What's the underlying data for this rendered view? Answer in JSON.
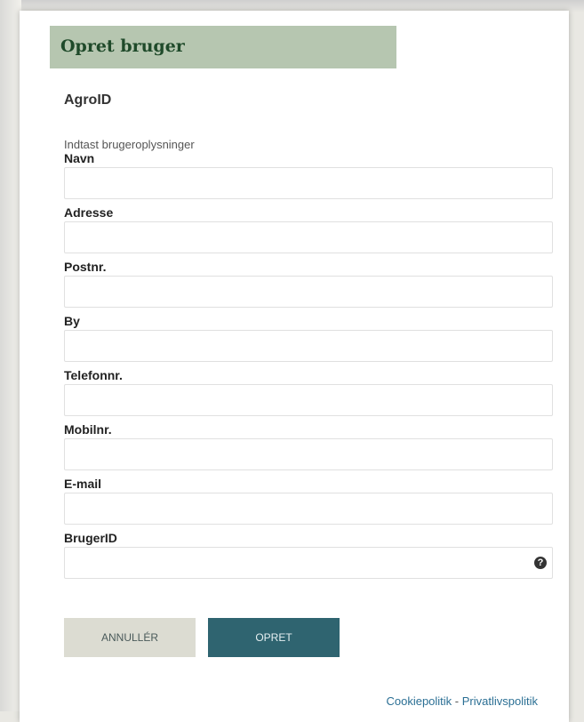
{
  "header": {
    "title": "Opret bruger"
  },
  "app_name": "AgroID",
  "subtitle": "Indtast brugeroplysninger",
  "fields": {
    "navn": {
      "label": "Navn",
      "value": ""
    },
    "adresse": {
      "label": "Adresse",
      "value": ""
    },
    "postnr": {
      "label": "Postnr.",
      "value": ""
    },
    "by": {
      "label": "By",
      "value": ""
    },
    "telefonnr": {
      "label": "Telefonnr.",
      "value": ""
    },
    "mobilnr": {
      "label": "Mobilnr.",
      "value": ""
    },
    "email": {
      "label": "E-mail",
      "value": ""
    },
    "brugerid": {
      "label": "BrugerID",
      "value": ""
    }
  },
  "help_icon_glyph": "?",
  "buttons": {
    "cancel": "ANNULLÉR",
    "create": "OPRET"
  },
  "footer": {
    "cookie": "Cookiepolitik",
    "separator": " - ",
    "privacy": "Privatlivspolitik"
  },
  "colors": {
    "header_bg": "#b6c6b0",
    "header_text": "#1f4a2a",
    "create_bg": "#2f6470",
    "cancel_bg": "#dcdcd2",
    "link": "#2b6f94"
  }
}
